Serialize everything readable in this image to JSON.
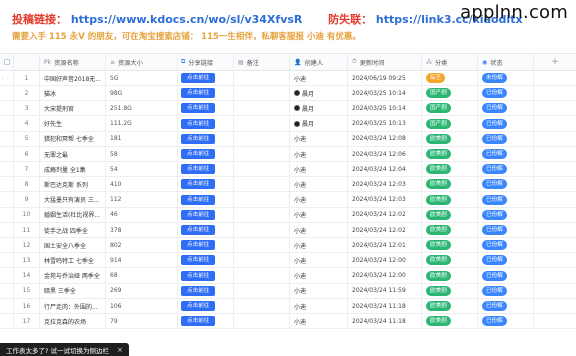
{
  "banner": {
    "submit_label": "投稿链接：",
    "submit_url": "https://www.kdocs.cn/wo/sl/v34XfvsR",
    "anti_label": "防失联：",
    "anti_url": "https://link3.cc/xiaoditx",
    "notice": "需要入手 115 永V 的朋友，可在淘宝搜索店铺： 115一生相伴，私聊客服报 小迪 有优惠。",
    "brand": "applnn.com"
  },
  "table": {
    "headers": {
      "name": "资源名称",
      "size": "资源大小",
      "link": "分享链接",
      "note": "备注",
      "creator": "创建人",
      "time": "更新时间",
      "category": "分类",
      "status": "状态",
      "add": "+"
    },
    "go_button_label": "点击前往",
    "rows": [
      {
        "idx": "1",
        "name": "中国好声音2018无...",
        "size": "5G",
        "creator": "小迪",
        "creator_avatar": false,
        "time": "2024/06/19 09:25",
        "category": "综艺",
        "category_color": "orange",
        "status": "未份解"
      },
      {
        "idx": "2",
        "name": "猫冰",
        "size": "98G",
        "creator": "晨月",
        "creator_avatar": true,
        "time": "2024/03/25 10:14",
        "category": "国产剧",
        "category_color": "green",
        "status": "已份解"
      },
      {
        "idx": "3",
        "name": "大宋提刑官",
        "size": "251.8G",
        "creator": "晨月",
        "creator_avatar": true,
        "time": "2024/03/25 10:14",
        "category": "国产剧",
        "category_color": "green",
        "status": "已份解"
      },
      {
        "idx": "4",
        "name": "好先生",
        "size": "111.2G",
        "creator": "晨月",
        "creator_avatar": true,
        "time": "2024/03/25 10:13",
        "category": "国产剧",
        "category_color": "green",
        "status": "已份解"
      },
      {
        "idx": "5",
        "name": "猎犯和冥帮 七季全",
        "size": "181",
        "creator": "小迪",
        "creator_avatar": false,
        "time": "2024/03/24 12:08",
        "category": "欧美剧",
        "category_color": "green",
        "status": "已份解"
      },
      {
        "idx": "6",
        "name": "无罪之最",
        "size": "58",
        "creator": "小迪",
        "creator_avatar": false,
        "time": "2024/03/24 12:06",
        "category": "欧美剧",
        "category_color": "green",
        "status": "已份解"
      },
      {
        "idx": "7",
        "name": "成瘾剂量 全1集",
        "size": "54",
        "creator": "小迪",
        "creator_avatar": false,
        "time": "2024/03/24 12:04",
        "category": "欧美剧",
        "category_color": "green",
        "status": "已份解"
      },
      {
        "idx": "8",
        "name": "斯巴达克斯 系列",
        "size": "410",
        "creator": "小迪",
        "creator_avatar": false,
        "time": "2024/03/24 12:03",
        "category": "欧美剧",
        "category_color": "green",
        "status": "已份解"
      },
      {
        "idx": "9",
        "name": "大猛墨只有演员 三...",
        "size": "112",
        "creator": "小迪",
        "creator_avatar": false,
        "time": "2024/03/24 12:03",
        "category": "欧美剧",
        "category_color": "green",
        "status": "已份解"
      },
      {
        "idx": "10",
        "name": "婚姻生活(杜比视界...",
        "size": "46",
        "creator": "小迪",
        "creator_avatar": false,
        "time": "2024/03/24 12:02",
        "category": "欧美剧",
        "category_color": "green",
        "status": "已份解"
      },
      {
        "idx": "11",
        "name": "徒手之战 四季全",
        "size": "378",
        "creator": "小迪",
        "creator_avatar": false,
        "time": "2024/03/24 12:02",
        "category": "欧美剧",
        "category_color": "green",
        "status": "已份解"
      },
      {
        "idx": "12",
        "name": "国土安全八季全",
        "size": "802",
        "creator": "小迪",
        "creator_avatar": false,
        "time": "2024/03/24 12:01",
        "category": "欧美剧",
        "category_color": "green",
        "status": "已份解"
      },
      {
        "idx": "13",
        "name": "林雪鸣特工 七季全",
        "size": "914",
        "creator": "小迪",
        "creator_avatar": false,
        "time": "2024/03/24 12:00",
        "category": "欧美剧",
        "category_color": "green",
        "status": "已份解"
      },
      {
        "idx": "14",
        "name": "金苑与乔治娅 两季全",
        "size": "68",
        "creator": "小迪",
        "creator_avatar": false,
        "time": "2024/03/24 12:00",
        "category": "欧美剧",
        "category_color": "green",
        "status": "已份解"
      },
      {
        "idx": "15",
        "name": "暗黑 三季全",
        "size": "269",
        "creator": "小迪",
        "creator_avatar": false,
        "time": "2024/03/24 11:59",
        "category": "欧美剧",
        "category_color": "green",
        "status": "已份解"
      },
      {
        "idx": "16",
        "name": "行尸走肉：外围的...",
        "size": "106",
        "creator": "小迪",
        "creator_avatar": false,
        "time": "2024/03/24 11:18",
        "category": "欧美剧",
        "category_color": "green",
        "status": "已份解"
      },
      {
        "idx": "17",
        "name": "克拉克森的农场",
        "size": "79",
        "creator": "小迪",
        "creator_avatar": false,
        "time": "2024/03/24 11:18",
        "category": "欧美剧",
        "category_color": "green",
        "status": "已份解"
      }
    ]
  },
  "toast": {
    "text": "工作表太多了? 试一试切换为侧边栏",
    "close": "×"
  },
  "colors": {
    "primary": "#2f6df6",
    "tag_orange": "#f5a52a",
    "tag_green": "#2bb673",
    "tag_blue": "#3a86ff",
    "banner_blue": "#2b6fd6",
    "banner_red": "#e33a2b",
    "banner_orange": "#e6a23c"
  }
}
